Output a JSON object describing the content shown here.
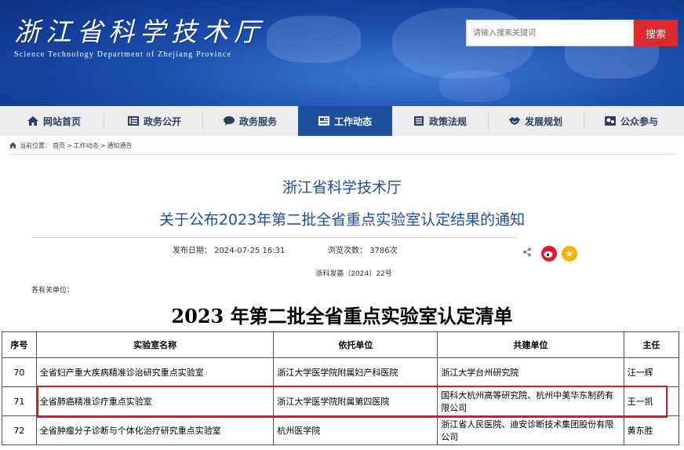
{
  "header": {
    "title": "浙江省科学技术厅",
    "subtitle": "Science Technology Department of Zhejiang Province",
    "search": {
      "placeholder": "请输入搜索关键词",
      "button_label": "搜索"
    }
  },
  "nav": {
    "items": [
      {
        "label": "网站首页",
        "icon": "home-icon"
      },
      {
        "label": "政务公开",
        "icon": "list-icon"
      },
      {
        "label": "政务服务",
        "icon": "chat-icon"
      },
      {
        "label": "工作动态",
        "icon": "news-icon",
        "active": true
      },
      {
        "label": "政策法规",
        "icon": "doc-icon"
      },
      {
        "label": "发展规划",
        "icon": "handshake-icon"
      },
      {
        "label": "公众参与",
        "icon": "people-icon"
      }
    ],
    "active_color": "#1e4f9c"
  },
  "breadcrumb": [
    "当前位置：",
    "首页",
    "工作动态",
    "通知通告"
  ],
  "article": {
    "org": "浙江省科学技术厅",
    "title": "关于公布2023年第二批全省重点实验室认定结果的通知",
    "publish_label": "发布日期：",
    "publish_date": "2024-07-25 16:31",
    "views_label": "浏览次数：",
    "views": "3786次",
    "doc_number": "浙科发基〔2024〕22号",
    "addressee": "各有关单位：",
    "list_title": "2023 年第二批全省重点实验室认定清单"
  },
  "table": {
    "headers": [
      "序号",
      "实验室名称",
      "依托单位",
      "共建单位",
      "主任"
    ],
    "rows": [
      {
        "no": "70",
        "name": "全省妇产重大疾病精准诊治研究重点实验室",
        "unit": "浙江大学医学院附属妇产科医院",
        "partner": "浙江大学台州研究院",
        "director": "汪一辉"
      },
      {
        "no": "71",
        "name": "全省肺癌精准诊疗重点实验室",
        "unit": "浙江大学医学院附属第四医院",
        "partner": "国科大杭州高等研究院、杭州中美华东制药有限公司",
        "director": "王一凯"
      },
      {
        "no": "72",
        "name": "全省肿瘤分子诊断与个体化治疗研究重点实验室",
        "unit": "杭州医学院",
        "partner": "浙江省人民医院、迪安诊断技术集团股份有限公司",
        "director": "黄东胜"
      }
    ]
  },
  "colors": {
    "brand_blue": "#1d4f9c",
    "search_red": "#d92b2b",
    "highlight_red": "#e01a1a"
  }
}
